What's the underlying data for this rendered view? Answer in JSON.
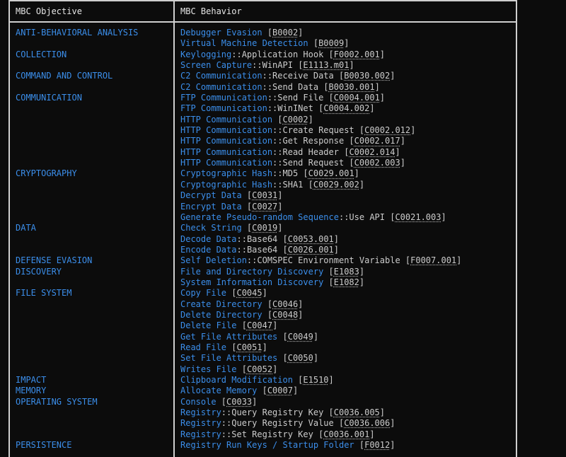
{
  "header": {
    "objective": "MBC Objective",
    "behavior": "MBC Behavior"
  },
  "colors": {
    "background": "#0c0c0c",
    "border": "#cfcfcf",
    "accent_blue": "#3b8eea",
    "text": "#cccccc"
  },
  "rows": [
    {
      "objective": "ANTI-BEHAVIORAL ANALYSIS",
      "name": "Debugger Evasion",
      "method": "",
      "id": "B0002"
    },
    {
      "objective": "",
      "name": "Virtual Machine Detection",
      "method": "",
      "id": "B0009"
    },
    {
      "objective": "COLLECTION",
      "name": "Keylogging",
      "method": "Application Hook",
      "id": "F0002.001"
    },
    {
      "objective": "",
      "name": "Screen Capture",
      "method": "WinAPI",
      "id": "E1113.m01"
    },
    {
      "objective": "COMMAND AND CONTROL",
      "name": "C2 Communication",
      "method": "Receive Data",
      "id": "B0030.002"
    },
    {
      "objective": "",
      "name": "C2 Communication",
      "method": "Send Data",
      "id": "B0030.001"
    },
    {
      "objective": "COMMUNICATION",
      "name": "FTP Communication",
      "method": "Send File",
      "id": "C0004.001"
    },
    {
      "objective": "",
      "name": "FTP Communication",
      "method": "WinINet",
      "id": "C0004.002"
    },
    {
      "objective": "",
      "name": "HTTP Communication",
      "method": "",
      "id": "C0002"
    },
    {
      "objective": "",
      "name": "HTTP Communication",
      "method": "Create Request",
      "id": "C0002.012"
    },
    {
      "objective": "",
      "name": "HTTP Communication",
      "method": "Get Response",
      "id": "C0002.017"
    },
    {
      "objective": "",
      "name": "HTTP Communication",
      "method": "Read Header",
      "id": "C0002.014"
    },
    {
      "objective": "",
      "name": "HTTP Communication",
      "method": "Send Request",
      "id": "C0002.003"
    },
    {
      "objective": "CRYPTOGRAPHY",
      "name": "Cryptographic Hash",
      "method": "MD5",
      "id": "C0029.001"
    },
    {
      "objective": "",
      "name": "Cryptographic Hash",
      "method": "SHA1",
      "id": "C0029.002"
    },
    {
      "objective": "",
      "name": "Decrypt Data",
      "method": "",
      "id": "C0031"
    },
    {
      "objective": "",
      "name": "Encrypt Data",
      "method": "",
      "id": "C0027"
    },
    {
      "objective": "",
      "name": "Generate Pseudo-random Sequence",
      "method": "Use API",
      "id": "C0021.003"
    },
    {
      "objective": "DATA",
      "name": "Check String",
      "method": "",
      "id": "C0019"
    },
    {
      "objective": "",
      "name": "Decode Data",
      "method": "Base64",
      "id": "C0053.001"
    },
    {
      "objective": "",
      "name": "Encode Data",
      "method": "Base64",
      "id": "C0026.001"
    },
    {
      "objective": "DEFENSE EVASION",
      "name": "Self Deletion",
      "method": "COMSPEC Environment Variable",
      "id": "F0007.001"
    },
    {
      "objective": "DISCOVERY",
      "name": "File and Directory Discovery",
      "method": "",
      "id": "E1083"
    },
    {
      "objective": "",
      "name": "System Information Discovery",
      "method": "",
      "id": "E1082"
    },
    {
      "objective": "FILE SYSTEM",
      "name": "Copy File",
      "method": "",
      "id": "C0045"
    },
    {
      "objective": "",
      "name": "Create Directory",
      "method": "",
      "id": "C0046"
    },
    {
      "objective": "",
      "name": "Delete Directory",
      "method": "",
      "id": "C0048"
    },
    {
      "objective": "",
      "name": "Delete File",
      "method": "",
      "id": "C0047"
    },
    {
      "objective": "",
      "name": "Get File Attributes",
      "method": "",
      "id": "C0049"
    },
    {
      "objective": "",
      "name": "Read File",
      "method": "",
      "id": "C0051"
    },
    {
      "objective": "",
      "name": "Set File Attributes",
      "method": "",
      "id": "C0050"
    },
    {
      "objective": "",
      "name": "Writes File",
      "method": "",
      "id": "C0052"
    },
    {
      "objective": "IMPACT",
      "name": "Clipboard Modification",
      "method": "",
      "id": "E1510"
    },
    {
      "objective": "MEMORY",
      "name": "Allocate Memory",
      "method": "",
      "id": "C0007"
    },
    {
      "objective": "OPERATING SYSTEM",
      "name": "Console",
      "method": "",
      "id": "C0033"
    },
    {
      "objective": "",
      "name": "Registry",
      "method": "Query Registry Key",
      "id": "C0036.005"
    },
    {
      "objective": "",
      "name": "Registry",
      "method": "Query Registry Value",
      "id": "C0036.006"
    },
    {
      "objective": "",
      "name": "Registry",
      "method": "Set Registry Key",
      "id": "C0036.001"
    },
    {
      "objective": "PERSISTENCE",
      "name": "Registry Run Keys / Startup Folder",
      "method": "",
      "id": "F0012"
    }
  ]
}
